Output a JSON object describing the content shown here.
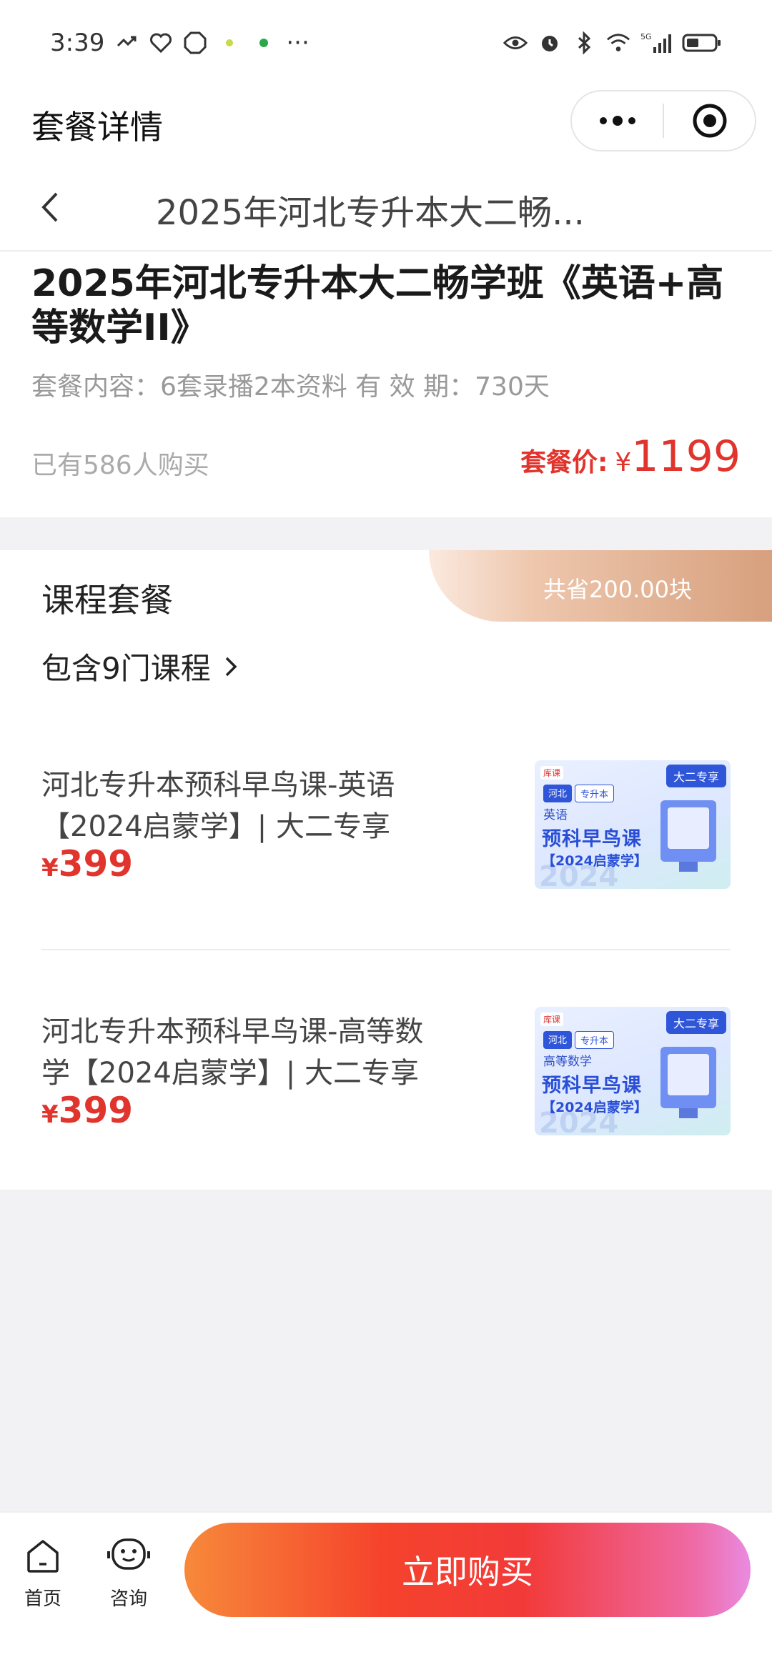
{
  "status_bar": {
    "time": "3:39",
    "more": "···",
    "network": "5G"
  },
  "title_bar": {
    "title": "套餐详情"
  },
  "nav": {
    "title": "2025年河北专升本大二畅..."
  },
  "package": {
    "title": "2025年河北专升本大二畅学班《英语+高等数学II》",
    "meta": "套餐内容：6套录播2本资料 有  效  期：730天",
    "buyers": "已有586人购买",
    "price_label": "套餐价:",
    "currency": "¥",
    "price": "1199"
  },
  "course_section": {
    "title": "课程套餐",
    "save_text": "共省200.00块",
    "includes": "包含9门课程",
    "items": [
      {
        "title": "河北专升本预科早鸟课-英语【2024启蒙学】| 大二专享",
        "currency": "¥",
        "price": "399",
        "thumb": {
          "corner_tag": "大二专享",
          "logo": "库课",
          "chip1": "河北",
          "chip2": "专升本",
          "subject": "英语",
          "big": "预科早鸟课",
          "year": "【2024启蒙学】",
          "watermark": "2024"
        }
      },
      {
        "title": "河北专升本预科早鸟课-高等数学【2024启蒙学】| 大二专享",
        "currency": "¥",
        "price": "399",
        "thumb": {
          "corner_tag": "大二专享",
          "logo": "库课",
          "chip1": "河北",
          "chip2": "专升本",
          "subject": "高等数学",
          "big": "预科早鸟课",
          "year": "【2024启蒙学】",
          "watermark": "2024"
        }
      }
    ]
  },
  "bottom_bar": {
    "home_label": "首页",
    "consult_label": "咨询",
    "buy_label": "立即购买"
  },
  "colors": {
    "accent_red": "#e0342c",
    "save_banner": "#d7a07e",
    "thumb_blue": "#2a4fd6"
  }
}
